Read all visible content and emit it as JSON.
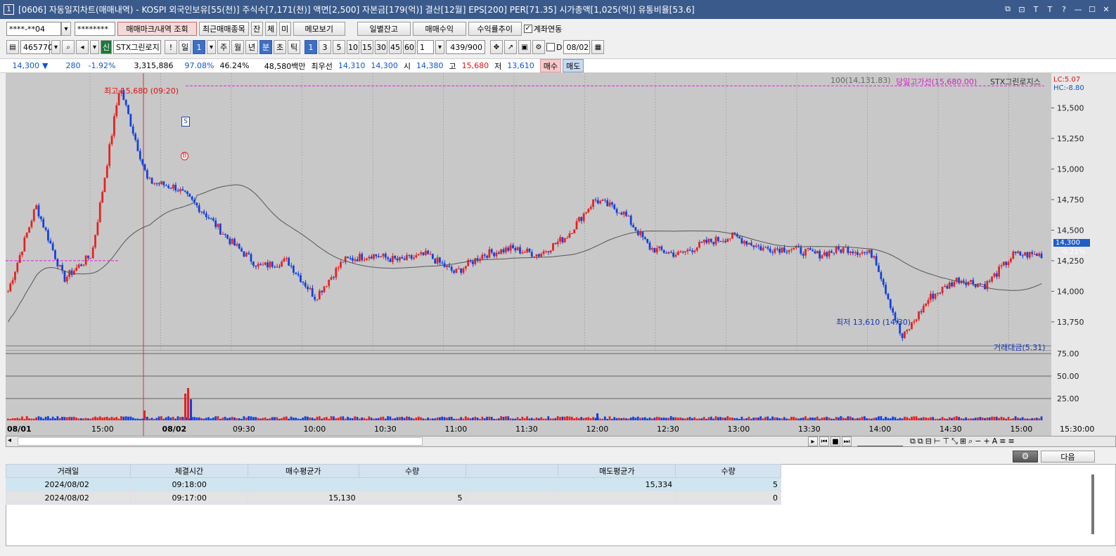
{
  "window": {
    "title": "[0606] 자동일지차트(매매내역) - KOSPI 외국인보유[55(천)] 주식수[7,171(천)] 액면[2,500] 자본금[179(억)] 결산[12월] EPS[200] PER[71.35] 시가총액[1,025(억)] 유통비율[53.6]",
    "num": "1",
    "buttons": [
      "⧉",
      "⊡",
      "T",
      "T",
      "?",
      "—",
      "☐",
      "✕"
    ]
  },
  "toolbar1": {
    "account": "****-**04",
    "password": "********",
    "btn_mark": "매매마크/내역 조회",
    "btn_recent": "최근매매종목",
    "jan": "잔",
    "che": "체",
    "mi": "미",
    "memo": "메모보기",
    "daily": "일별잔고",
    "profit": "매매수익",
    "rate": "수익률추이",
    "acct_link": "계좌연동"
  },
  "toolbar2": {
    "code": "465770",
    "sin": "신",
    "name": "STX그린로지",
    "excl": "!",
    "il": "일",
    "n1": "1",
    "ju": "주",
    "wol": "월",
    "nyeon": "년",
    "bun": "분",
    "cho": "초",
    "tik": "틱",
    "intervals": [
      "1",
      "3",
      "5",
      "10",
      "15",
      "30",
      "45",
      "60"
    ],
    "count": "1",
    "bars": "439",
    "bars_total": "/900",
    "d": "D",
    "date": "08/02"
  },
  "quote": {
    "price": "14,300",
    "arrow": "▼",
    "change": "280",
    "pct": "-1.92%",
    "volume": "3,315,886",
    "vol_ratio": "97.08%",
    "v2": "46.24%",
    "amount": "48,580백만",
    "choi": "최우선",
    "bid": "14,310",
    "ask": "14,300",
    "si_label": "시",
    "open": "14,380",
    "go_label": "고",
    "high": "15,680",
    "jeo_label": "저",
    "low": "13,610",
    "buy": "매수",
    "sell": "매도"
  },
  "chart_labels": {
    "high_note": "최고 15,680 (09:20)",
    "low_note": "최저 13,610 (14:30)",
    "legend_ma": "100(14,131.83)",
    "legend_high": "당일고가선(15,680.00)",
    "legend_name": "STX그린로지스",
    "lc": "LC:5.07",
    "hc": "HC:-8.80",
    "price_tag": "14,300",
    "pct_tag": "-0.21%",
    "vol_legend": "거래대금(5.31)",
    "sell_mark": "S",
    "buy_mark": "B"
  },
  "chart_data": {
    "type": "candlestick",
    "y_ticks": [
      "15,500",
      "15,250",
      "15,000",
      "14,750",
      "14,500",
      "14,250",
      "14,000",
      "13,750"
    ],
    "vol_ticks": [
      "75.00",
      "50.00",
      "25.00"
    ],
    "x_ticks": [
      "08/01",
      "15:00",
      "08/02",
      "09:30",
      "10:00",
      "10:30",
      "11:00",
      "11:30",
      "12:00",
      "12:30",
      "13:00",
      "13:30",
      "14:00",
      "14:30",
      "15:00",
      "15:30:00"
    ],
    "ylim": [
      13600,
      15750
    ],
    "high_line": 15680,
    "prev_high_line": 14250,
    "ma100": 14131.83,
    "key_prices": [
      14000,
      14700,
      14100,
      14300,
      15680,
      14900,
      14850,
      14650,
      14400,
      14200,
      14250,
      13950,
      14250,
      14300,
      14250,
      14300,
      14150,
      14300,
      14350,
      14300,
      14450,
      14750,
      14650,
      14350,
      14300,
      14400,
      14450,
      14350,
      14350,
      14300,
      14350,
      14300,
      13610,
      13950,
      14100,
      14050,
      14300,
      14300
    ]
  },
  "scroll_tools": [
    "▸",
    "⏮",
    "■",
    "⏭"
  ],
  "table": {
    "headers": [
      "거래일",
      "체결시간",
      "매수평균가",
      "수량",
      "",
      "매도평균가",
      "수량"
    ],
    "rows": [
      [
        "2024/08/02",
        "09:18:00",
        "",
        "",
        "",
        "15,334",
        "5"
      ],
      [
        "2024/08/02",
        "09:17:00",
        "15,130",
        "5",
        "",
        "",
        "0"
      ]
    ],
    "next": "다음"
  }
}
